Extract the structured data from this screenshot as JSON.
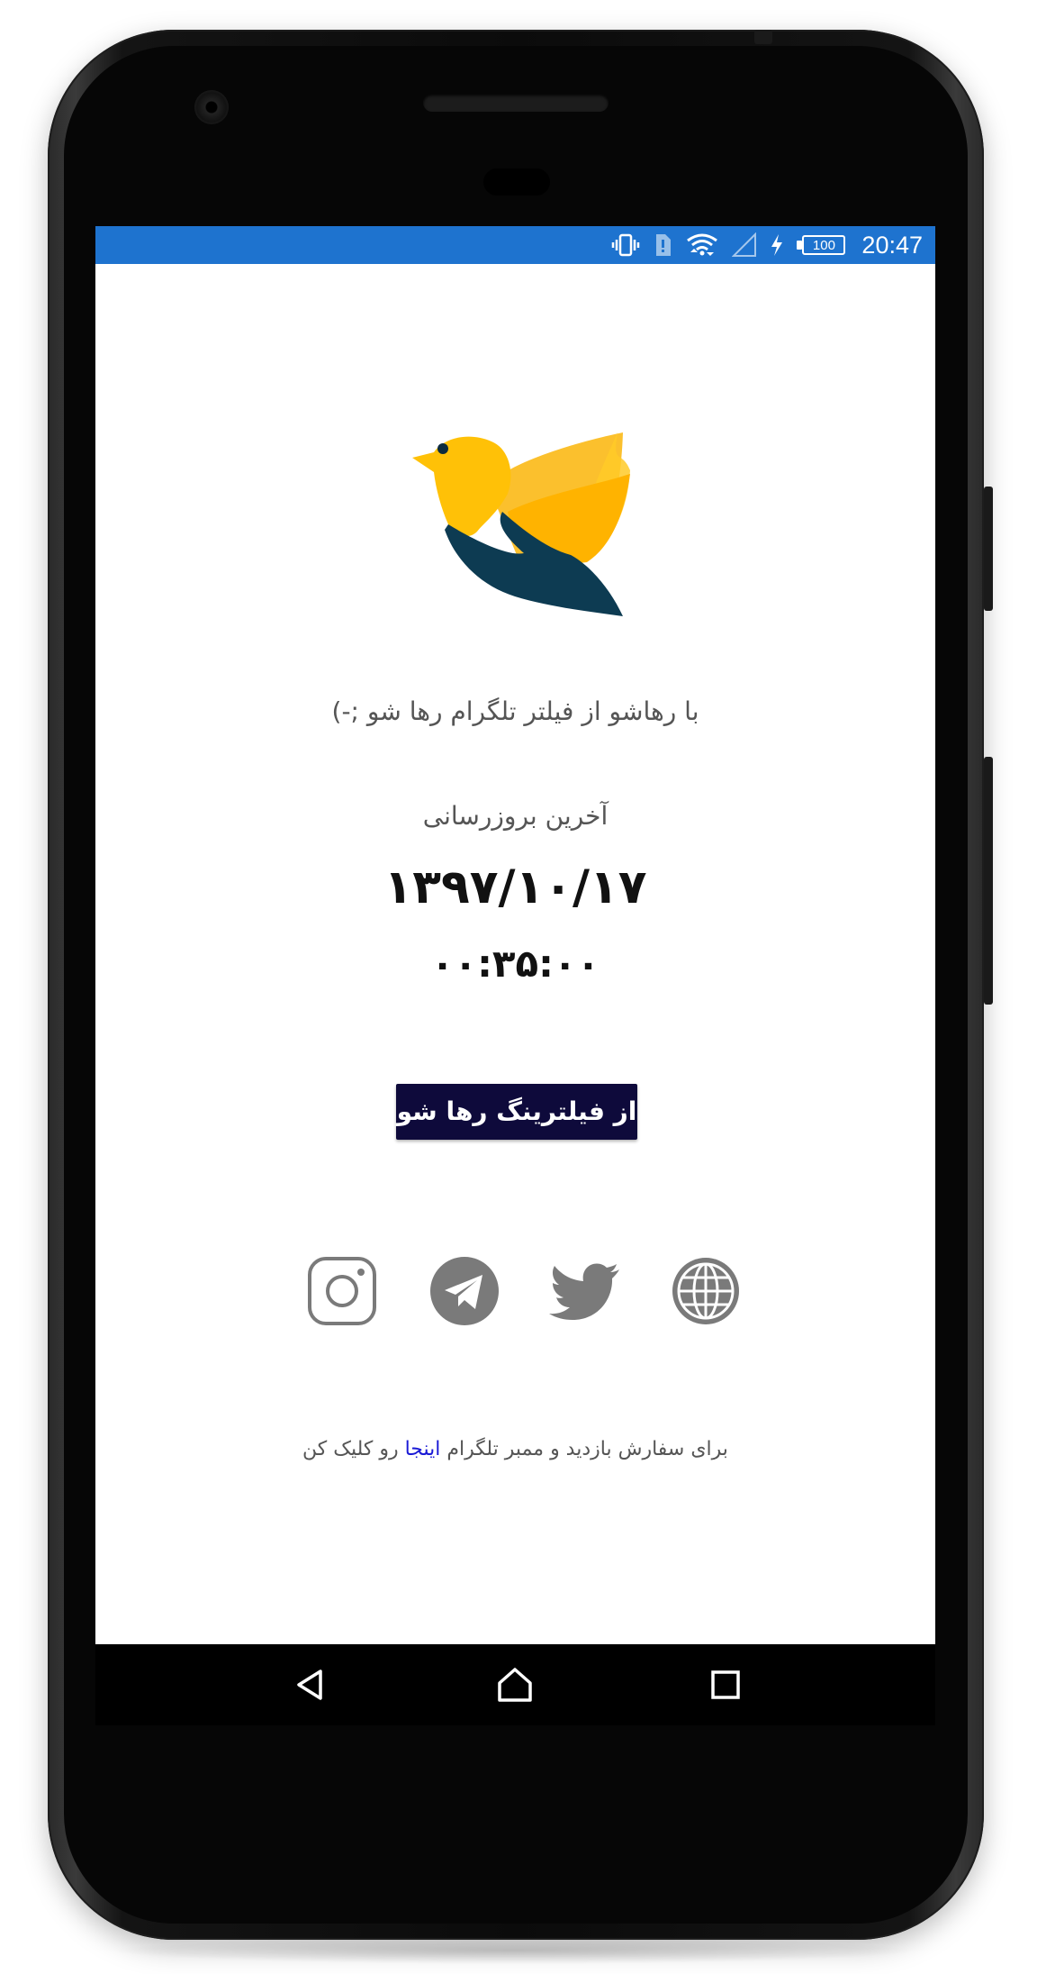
{
  "status_bar": {
    "time": "20:47",
    "battery": "100",
    "icons": [
      "vibrate-icon",
      "sim-alert-icon",
      "wifi-icon",
      "cell-signal-icon",
      "charging-icon",
      "battery-icon"
    ],
    "background_color": "#1e73cf"
  },
  "app": {
    "tagline": "با رهاشو از فیلتر تلگرام رها شو ;-)",
    "last_update_label": "آخرین بروزرسانی",
    "last_update_date": "۱۳۹۷/۱۰/۱۷",
    "last_update_time": "۰۰:۳۵:۰۰",
    "cta_label": "از فیلترینگ رها شو",
    "cta_color": "#0e0a3b",
    "socials": [
      "globe-icon",
      "twitter-icon",
      "telegram-icon",
      "instagram-icon"
    ],
    "footer_prefix": "برای سفارش بازدید و ممبر تلگرام",
    "footer_link": "اینجا",
    "footer_suffix": "رو کلیک کن",
    "link_color": "#1a1ad6"
  },
  "nav_bar": {
    "buttons": [
      "back-icon",
      "home-icon",
      "recents-icon"
    ]
  }
}
